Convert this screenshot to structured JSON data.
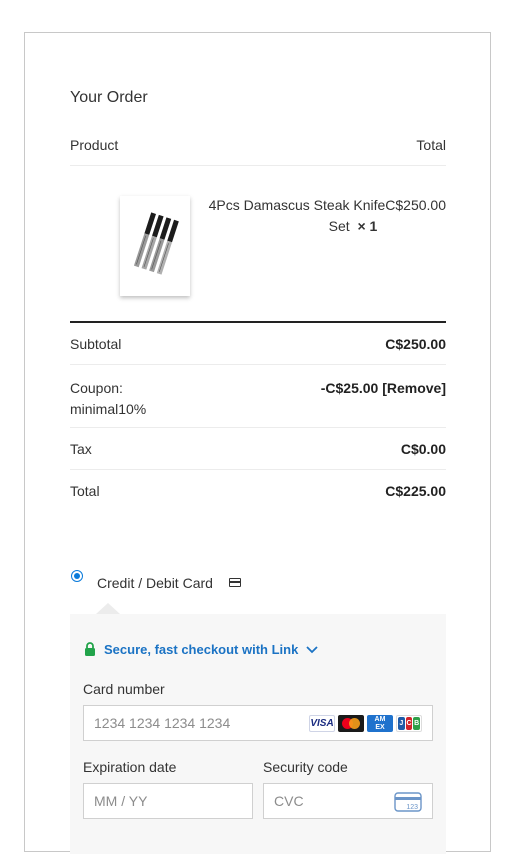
{
  "order": {
    "title": "Your Order",
    "col_product": "Product",
    "col_total": "Total",
    "item": {
      "name": "4Pcs Damascus Steak KnifeC$250.00",
      "name_line2": "Set",
      "qty": "× 1"
    },
    "rows": [
      {
        "label": "Subtotal",
        "value": "C$250.00"
      },
      {
        "label": "Coupon:",
        "label2": "minimal10%",
        "value": "-C$25.00 [Remove]"
      },
      {
        "label": "Tax",
        "value": "C$0.00"
      },
      {
        "label": "Total",
        "value": "C$225.00"
      }
    ]
  },
  "payment": {
    "method_label": "Credit / Debit Card",
    "method_selected": true,
    "link_text": "Secure, fast checkout with Link",
    "card_number_label": "Card number",
    "card_number_placeholder": "1234 1234 1234 1234",
    "expiry_label": "Expiration date",
    "expiry_placeholder": "MM / YY",
    "security_label": "Security code",
    "security_placeholder": "CVC",
    "cvc_icon_text": "123",
    "brands": {
      "visa": "VISA",
      "amex_top": "AM",
      "amex_bottom": "EX",
      "jcb_j": "J",
      "jcb_c": "C",
      "jcb_b": "B"
    }
  },
  "colors": {
    "accent": "#1b73c4",
    "lock_green": "#22a34a"
  }
}
